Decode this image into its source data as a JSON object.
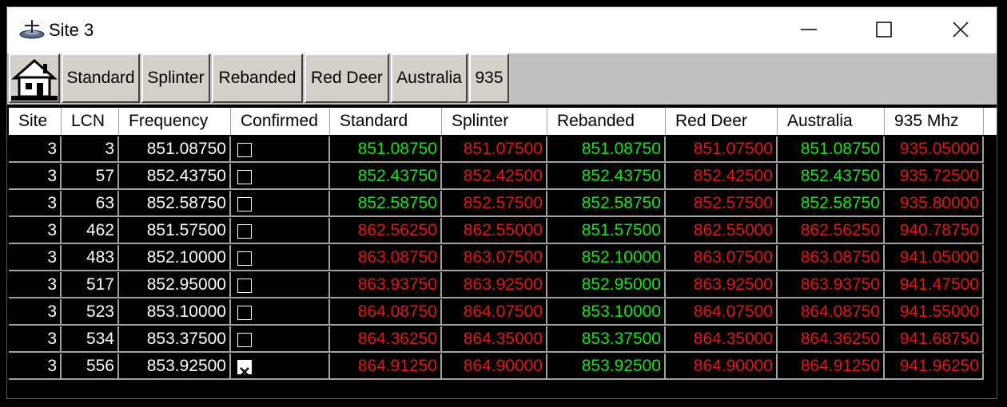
{
  "window": {
    "title": "Site 3"
  },
  "toolbar": {
    "tabs": [
      "Standard",
      "Splinter",
      "Rebanded",
      "Red Deer",
      "Australia",
      "935"
    ]
  },
  "table": {
    "columns": [
      "Site",
      "LCN",
      "Frequency",
      "Confirmed",
      "Standard",
      "Splinter",
      "Rebanded",
      "Red Deer",
      "Australia",
      "935 Mhz"
    ],
    "rows": [
      {
        "site": "3",
        "lcn": "3",
        "frequency": "851.08750",
        "confirmed": false,
        "standard": "851.08750",
        "splinter": "851.07500",
        "rebanded": "851.08750",
        "red_deer": "851.07500",
        "australia": "851.08750",
        "mhz935": "935.05000",
        "colors": [
          "green",
          "red",
          "green",
          "red",
          "green",
          "red"
        ]
      },
      {
        "site": "3",
        "lcn": "57",
        "frequency": "852.43750",
        "confirmed": false,
        "standard": "852.43750",
        "splinter": "852.42500",
        "rebanded": "852.43750",
        "red_deer": "852.42500",
        "australia": "852.43750",
        "mhz935": "935.72500",
        "colors": [
          "green",
          "red",
          "green",
          "red",
          "green",
          "red"
        ]
      },
      {
        "site": "3",
        "lcn": "63",
        "frequency": "852.58750",
        "confirmed": false,
        "standard": "852.58750",
        "splinter": "852.57500",
        "rebanded": "852.58750",
        "red_deer": "852.57500",
        "australia": "852.58750",
        "mhz935": "935.80000",
        "colors": [
          "green",
          "red",
          "green",
          "red",
          "green",
          "red"
        ]
      },
      {
        "site": "3",
        "lcn": "462",
        "frequency": "851.57500",
        "confirmed": false,
        "standard": "862.56250",
        "splinter": "862.55000",
        "rebanded": "851.57500",
        "red_deer": "862.55000",
        "australia": "862.56250",
        "mhz935": "940.78750",
        "colors": [
          "red",
          "red",
          "green",
          "red",
          "red",
          "red"
        ]
      },
      {
        "site": "3",
        "lcn": "483",
        "frequency": "852.10000",
        "confirmed": false,
        "standard": "863.08750",
        "splinter": "863.07500",
        "rebanded": "852.10000",
        "red_deer": "863.07500",
        "australia": "863.08750",
        "mhz935": "941.05000",
        "colors": [
          "red",
          "red",
          "green",
          "red",
          "red",
          "red"
        ]
      },
      {
        "site": "3",
        "lcn": "517",
        "frequency": "852.95000",
        "confirmed": false,
        "standard": "863.93750",
        "splinter": "863.92500",
        "rebanded": "852.95000",
        "red_deer": "863.92500",
        "australia": "863.93750",
        "mhz935": "941.47500",
        "colors": [
          "red",
          "red",
          "green",
          "red",
          "red",
          "red"
        ]
      },
      {
        "site": "3",
        "lcn": "523",
        "frequency": "853.10000",
        "confirmed": false,
        "standard": "864.08750",
        "splinter": "864.07500",
        "rebanded": "853.10000",
        "red_deer": "864.07500",
        "australia": "864.08750",
        "mhz935": "941.55000",
        "colors": [
          "red",
          "red",
          "green",
          "red",
          "red",
          "red"
        ]
      },
      {
        "site": "3",
        "lcn": "534",
        "frequency": "853.37500",
        "confirmed": false,
        "standard": "864.36250",
        "splinter": "864.35000",
        "rebanded": "853.37500",
        "red_deer": "864.35000",
        "australia": "864.36250",
        "mhz935": "941.68750",
        "colors": [
          "red",
          "red",
          "green",
          "red",
          "red",
          "red"
        ]
      },
      {
        "site": "3",
        "lcn": "556",
        "frequency": "853.92500",
        "confirmed": true,
        "standard": "864.91250",
        "splinter": "864.90000",
        "rebanded": "853.92500",
        "red_deer": "864.90000",
        "australia": "864.91250",
        "mhz935": "941.96250",
        "colors": [
          "red",
          "red",
          "green",
          "red",
          "red",
          "red"
        ]
      }
    ]
  },
  "icons": {
    "app": "radio-tower-icon",
    "home": "house-icon",
    "minimize": "minimize-icon",
    "maximize": "maximize-icon",
    "close": "close-icon",
    "checkbox_checked": "checkbox-checked-icon"
  },
  "colors": {
    "green": "#14e614",
    "red": "#e61414",
    "grid_bg": "#000000"
  }
}
